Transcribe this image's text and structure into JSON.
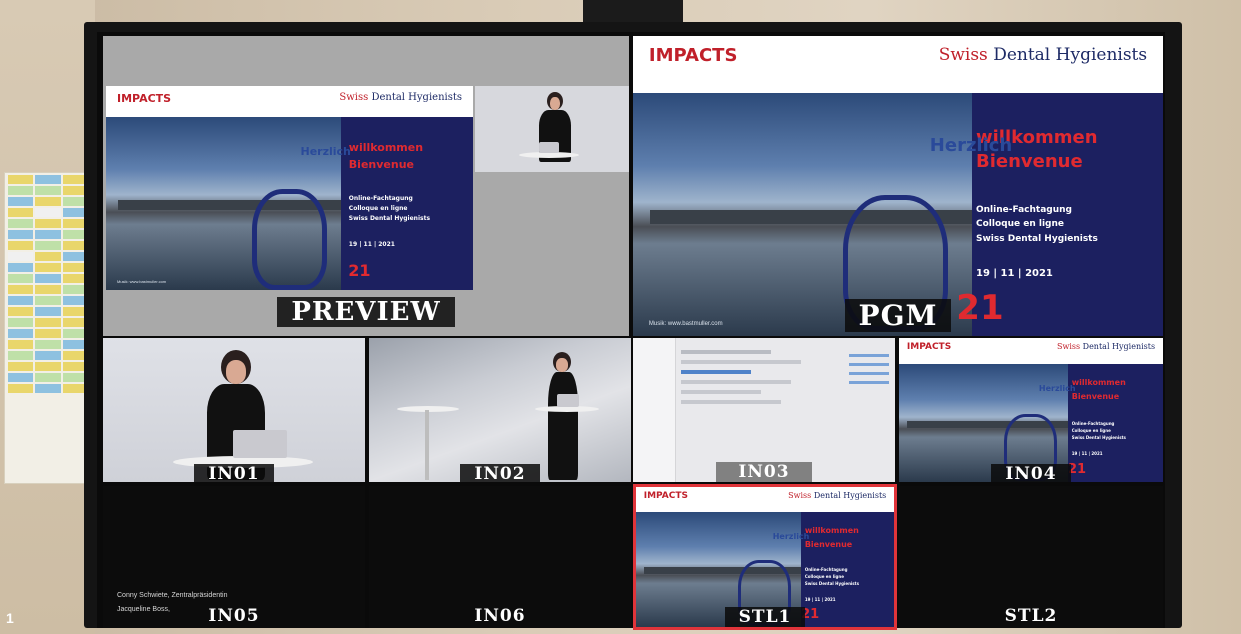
{
  "figure_number": "1",
  "slide": {
    "impacts": "IMPACTS",
    "brand_prefix": "Swiss",
    "brand_rest": "Dental Hygienists",
    "herzlich": "Herzlich",
    "willkommen": "willkommen",
    "bienvenue": "Bienvenue",
    "line1": "Online-Fachtagung",
    "line2": "Colloque en ligne",
    "line3": "Swiss Dental Hygienists",
    "date": "19 | 11 | 2021",
    "num": "21",
    "credit": "Musik: www.bastmuller.com"
  },
  "multiview": {
    "preview_label": "PREVIEW",
    "pgm_label": "PGM",
    "in01": "IN01",
    "in02": "IN02",
    "in03": "IN03",
    "in04": "IN04",
    "in05": "IN05",
    "in06": "IN06",
    "stl1": "STL1",
    "stl2": "STL2"
  },
  "lower_thirds": {
    "line1": "Conny Schwiete, Zentralpräsidentin",
    "line2": "Jacqueline Boss,"
  },
  "colors": {
    "accent_red": "#e02a30",
    "navy": "#1c2060",
    "tally_red": "#e0343a"
  }
}
